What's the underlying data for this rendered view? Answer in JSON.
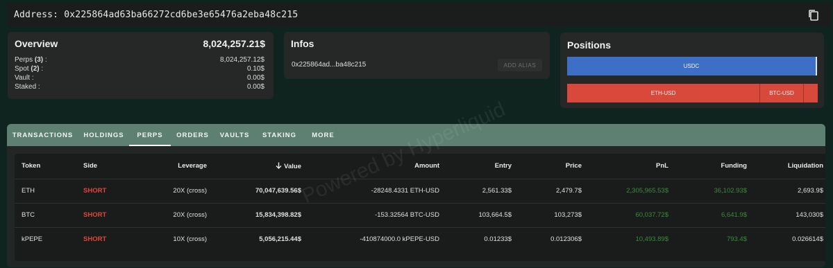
{
  "address": {
    "label": "Address:",
    "value": "0x225864ad63ba66272cd6be3e65476a2eba48c215"
  },
  "overview": {
    "title": "Overview",
    "total": "8,024,257.21$",
    "rows": [
      {
        "label": "Perps",
        "count": "(3)",
        "suffix": " :",
        "value": "8,024,257.12$"
      },
      {
        "label": "Spot",
        "count": "(2)",
        "suffix": " :",
        "value": "0.10$"
      },
      {
        "label": "Vault",
        "count": "",
        "suffix": " :",
        "value": "0.00$"
      },
      {
        "label": "Staked",
        "count": "",
        "suffix": " :",
        "value": "0.00$"
      }
    ]
  },
  "infos": {
    "title": "Infos",
    "short_address": "0x225864ad...ba48c215",
    "alias_button": "ADD ALIAS"
  },
  "positions": {
    "title": "Positions",
    "long": [
      {
        "label": "USDC"
      }
    ],
    "short": [
      {
        "label": "ETH-USD"
      },
      {
        "label": "BTC-USD"
      },
      {
        "label": ""
      }
    ]
  },
  "tabs": [
    "TRANSACTIONS",
    "HOLDINGS",
    "PERPS",
    "ORDERS",
    "VAULTS",
    "STAKING",
    "MORE"
  ],
  "active_tab": "PERPS",
  "table": {
    "columns": [
      "Token",
      "Side",
      "Leverage",
      "Value",
      "Amount",
      "Entry",
      "Price",
      "PnL",
      "Funding",
      "Liquidation"
    ],
    "sort_column": "Value",
    "rows": [
      {
        "token": "ETH",
        "side": "SHORT",
        "leverage": "20X (cross)",
        "value": "70,047,639.56$",
        "amount": "-28248.4331 ETH-USD",
        "entry": "2,561.33$",
        "price": "2,479.7$",
        "pnl": "2,305,965.53$",
        "funding": "36,102.93$",
        "liquidation": "2,693.9$"
      },
      {
        "token": "BTC",
        "side": "SHORT",
        "leverage": "20X (cross)",
        "value": "15,834,398.82$",
        "amount": "-153.32564 BTC-USD",
        "entry": "103,664.5$",
        "price": "103,273$",
        "pnl": "60,037.72$",
        "funding": "6,641.9$",
        "liquidation": "143,030$"
      },
      {
        "token": "kPEPE",
        "side": "SHORT",
        "leverage": "10X (cross)",
        "value": "5,056,215.44$",
        "amount": "-410874000.0 kPEPE-USD",
        "entry": "0.01233$",
        "price": "0.012306$",
        "pnl": "10,493.89$",
        "funding": "793.4$",
        "liquidation": "0.026614$"
      }
    ]
  },
  "watermark": "Powered by Hyperliquid",
  "colors": {
    "background": "#10241f",
    "tabbar": "#5d8073",
    "long": "#3e6fc6",
    "short": "#d9493b",
    "positive": "#3b8a3b"
  }
}
